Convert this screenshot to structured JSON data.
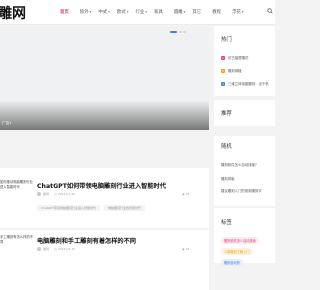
{
  "header": {
    "logo": "雕网",
    "nav": [
      {
        "label": "首页",
        "dropdown": false,
        "active": true
      },
      {
        "label": "除外",
        "dropdown": true,
        "active": false
      },
      {
        "label": "中式",
        "dropdown": true,
        "active": false
      },
      {
        "label": "欧式",
        "dropdown": true,
        "active": false
      },
      {
        "label": "行业",
        "dropdown": true,
        "active": false
      },
      {
        "label": "家具",
        "dropdown": false,
        "active": false
      },
      {
        "label": "圆雕",
        "dropdown": true,
        "active": false
      },
      {
        "label": "其它",
        "dropdown": false,
        "active": false
      },
      {
        "label": "教程",
        "dropdown": false,
        "active": false
      },
      {
        "label": "浮花",
        "dropdown": true,
        "active": false
      }
    ],
    "search_icon": "search-icon",
    "accent_color": "#e0457b"
  },
  "banner": {
    "caption": "广告1",
    "active_slide_color": "#4a7bd8"
  },
  "articles": [
    {
      "thumb_text": "如何推动电脑雕刻行业进入智能时代",
      "title": "ChatGPT如何带领电脑雕刻行业进入智能时代",
      "author": "雕网",
      "date": "2023-03-30",
      "views": "46",
      "tags": [
        "ChatGPT带领电脑雕刻行业进入智能时代",
        "电脑雕刻行业的智能时代"
      ]
    },
    {
      "thumb_text": "手工雕刻有怎么样的不同",
      "title": "电脑雕刻和手工雕刻有着怎样的不同",
      "author": "雕网",
      "date": "2023-03-30",
      "views": "46",
      "tags": []
    }
  ],
  "sidebar": {
    "hot": {
      "title": "热门",
      "items": [
        {
          "num": "1",
          "label": "仿古抽屉雕花",
          "color": "#e0457b"
        },
        {
          "num": "2",
          "label": "雕刻绿植",
          "color": "#f0a030"
        },
        {
          "num": "3",
          "label": "三维立体电脑雕刻：出于机",
          "color": "#4a7bd8"
        }
      ]
    },
    "recommend": {
      "title": "推荐"
    },
    "random": {
      "title": "随机",
      "items": [
        "雕刻软件怎么自动排版？",
        "雕刻排版",
        "建议雕刻入门的常用雕刻字"
      ]
    },
    "tags_card": {
      "title": "标签",
      "pills": [
        {
          "label": "雕刻软件怎么自动排版",
          "color": "#e0457b",
          "bg": "#fde8ef"
        },
        {
          "label": "人物雕刻了解入门",
          "color": "#f0a030",
          "bg": "#fdf1df"
        },
        {
          "label": "雕刻自动的",
          "color": "#4a7bd8",
          "bg": "#e6eefc"
        }
      ]
    }
  }
}
